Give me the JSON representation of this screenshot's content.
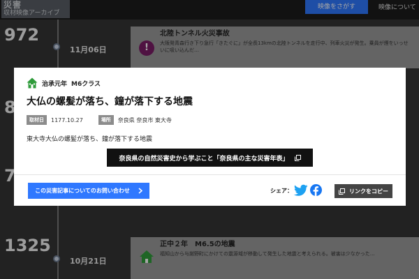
{
  "header": {
    "logo_line1": "災害",
    "logo_line2": "収材映像アーカイブ",
    "search_button": "映像をさがす",
    "about_link": "映像について"
  },
  "timeline": [
    {
      "year": "972",
      "date": "11月06日"
    },
    {
      "year": "8",
      "date": ""
    },
    {
      "year": "7",
      "date": ""
    },
    {
      "year": "1325",
      "date": "10月21日"
    }
  ],
  "background_cards": [
    {
      "title": "北陸トンネル火災事故",
      "text": "大阪発青森行き下り急行「きたぐに」が全長13kmの北陸トンネルを走行中、列車火災が発生。乗員が煙をいっせいに吸い込んだ…"
    },
    {
      "title": "正中２年　M6.5の地震",
      "text": "福知山から与謝野町にかけての震源域が移動して発生した地震と考えられる。被害は少なかった…"
    }
  ],
  "modal": {
    "era": "治承元年",
    "magnitude": "M6クラス",
    "title": "大仏の螺髪が落ち、鐘が落下する地震",
    "date_tag": "取材日",
    "date_value": "1177.10.27",
    "place_tag": "場所",
    "place_value": "奈良県 奈良市 東大寺",
    "description": "東大寺大仏の螺髪が落ち、鐘が落下する地震",
    "related_button": "奈良県の自然災害史から学ぶこと「奈良県の主な災害年表」",
    "contact_button": "この災害記事についてのお問い合わせ",
    "share_label": "シェア：",
    "copy_link_button": "リンクをコピー"
  },
  "colors": {
    "accent_blue": "#2f78ff",
    "twitter_blue": "#1da1f2",
    "facebook_blue": "#1877f2",
    "house_green": "#2e9b3a"
  }
}
